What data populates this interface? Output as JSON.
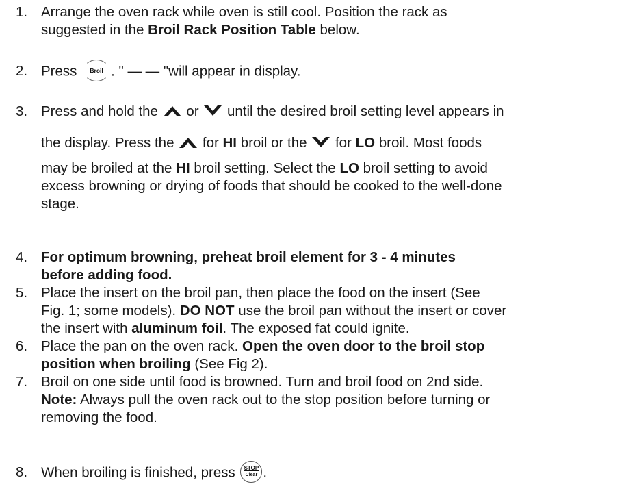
{
  "steps": [
    {
      "number": "1.",
      "line1": "Arrange the oven rack while oven is still cool. Position the rack as",
      "line2_a": "suggested in the ",
      "line2_bold": "Broil Rack Position Table",
      "line2_b": " below."
    },
    {
      "number": "2.",
      "text_a": "Press ",
      "key_label": "Broil",
      "text_b": ". \" — — \"will appear in display."
    },
    {
      "number": "3.",
      "line1_a": "Press and hold the ",
      "line1_b": " or ",
      "line1_c": "  until the desired broil setting level appears in",
      "line2_a": "the display. Press the ",
      "line2_b": " for ",
      "line2_hi": "HI",
      "line2_c": " broil or the ",
      "line2_d": " for ",
      "line2_lo": "LO",
      "line2_e": " broil. Most foods",
      "line3_a": "may be broiled at the ",
      "line3_hi": "HI",
      "line3_b": " broil setting. Select the ",
      "line3_lo": "LO",
      "line3_c": " broil setting to avoid",
      "line4": "excess browning or drying of foods that should be cooked to the well-done",
      "line5": "stage."
    },
    {
      "number": "4.",
      "line1_bold": "For optimum browning, preheat broil element for 3 - 4 minutes",
      "line2_bold": "before adding food."
    },
    {
      "number": "5.",
      "line1": "Place the insert on the broil pan, then place the food on the insert (See",
      "line2_a": "Fig. 1; some models). ",
      "line2_bold": "DO NOT",
      "line2_b": " use the broil pan without the insert or cover",
      "line3_a": "the insert with ",
      "line3_bold": "aluminum foil",
      "line3_b": ". The exposed fat could ignite."
    },
    {
      "number": "6.",
      "line1_a": "Place the pan on the oven rack. ",
      "line1_bold": "Open the oven door to the broil stop",
      "line2_bold": "position when broiling",
      "line2_b": " (See Fig 2)."
    },
    {
      "number": "7.",
      "line1": "Broil on one side until food is browned. Turn and broil food on 2nd side.",
      "line2_bold": "Note:",
      "line2_b": " Always pull the oven rack out to the stop position before turning or",
      "line3": "removing the food."
    },
    {
      "number": "8.",
      "text_a": "When broiling is finished, press ",
      "key_top": "STOP",
      "key_bottom": "Clear",
      "text_b": "."
    }
  ],
  "icons": {
    "up": "caret-up-icon",
    "down": "caret-down-icon"
  }
}
